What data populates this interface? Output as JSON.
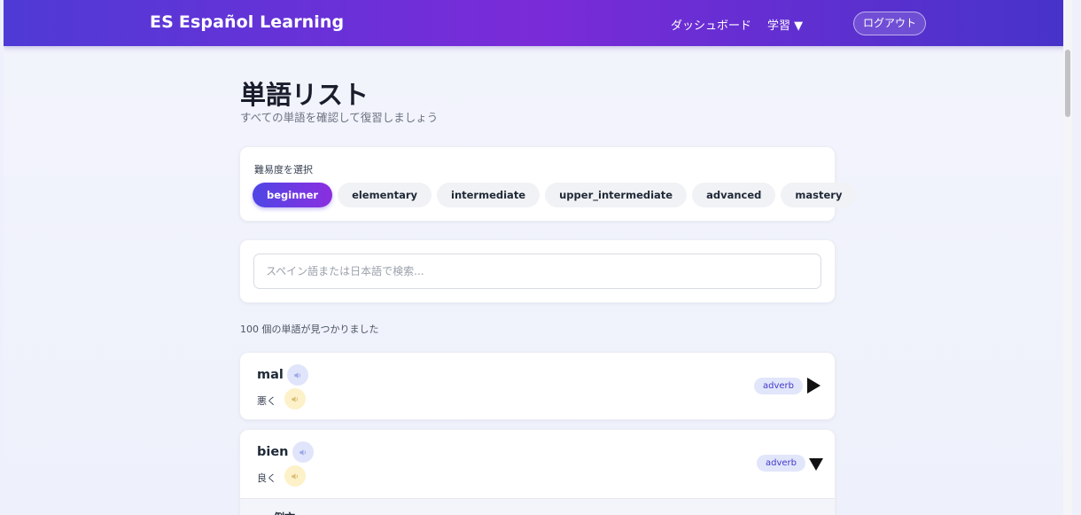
{
  "header": {
    "brand_code": "ES",
    "brand_name": "Español Learning",
    "nav_dashboard": "ダッシュボード",
    "nav_study": "学習 ▼",
    "logout_label": "ログアウト"
  },
  "page": {
    "title": "単語リスト",
    "subtitle": "すべての単語を確認して復習しましょう"
  },
  "difficulty": {
    "label": "難易度を選択",
    "options": [
      "beginner",
      "elementary",
      "intermediate",
      "upper_intermediate",
      "advanced",
      "mastery"
    ],
    "selected": "beginner"
  },
  "search": {
    "placeholder": "スペイン語または日本語で検索...",
    "value": ""
  },
  "results": {
    "count_text": "100 個の単語が見つかりました"
  },
  "words": [
    {
      "spanish": "mal",
      "japanese": "悪く",
      "pos": "adverb",
      "expanded": false
    },
    {
      "spanish": "bien",
      "japanese": "良く",
      "pos": "adverb",
      "expanded": true,
      "example_label": "例文"
    }
  ],
  "icons": {
    "audio": "speaker-icon",
    "collapsed": "caret-right-icon",
    "expanded": "caret-down-icon"
  },
  "colors": {
    "header_start": "#4f3ad6",
    "header_mid": "#7a2bd8",
    "accent": "#4f46e5",
    "pos_badge_bg": "#e2e6fb",
    "pos_badge_text": "#4338ca",
    "audio_es_bg": "#e0e5fb",
    "audio_jp_bg": "#fdf1c9"
  }
}
